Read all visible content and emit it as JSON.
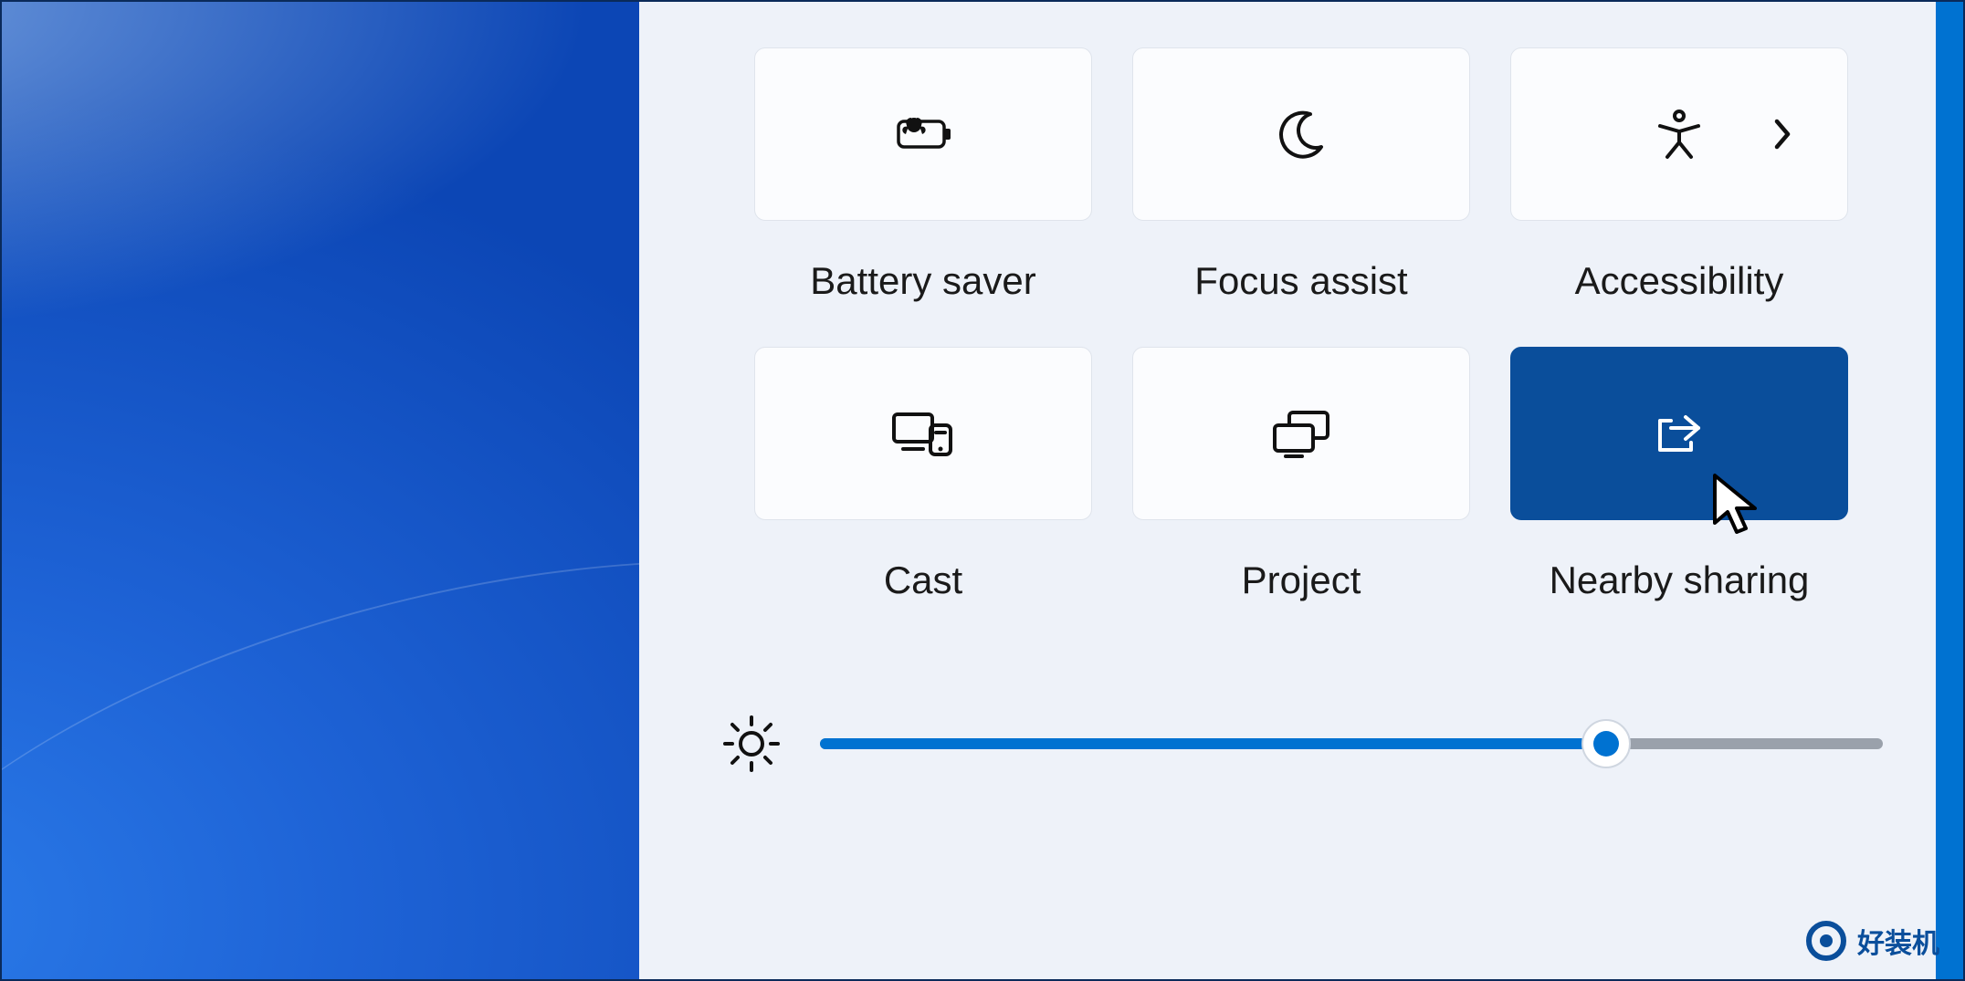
{
  "quick_settings": {
    "tiles": [
      {
        "id": "battery-saver",
        "label": "Battery saver",
        "icon": "battery-saver-icon",
        "active": false,
        "has_submenu": false
      },
      {
        "id": "focus-assist",
        "label": "Focus assist",
        "icon": "moon-icon",
        "active": false,
        "has_submenu": false
      },
      {
        "id": "accessibility",
        "label": "Accessibility",
        "icon": "accessibility-icon",
        "active": false,
        "has_submenu": true
      },
      {
        "id": "cast",
        "label": "Cast",
        "icon": "cast-icon",
        "active": false,
        "has_submenu": false
      },
      {
        "id": "project",
        "label": "Project",
        "icon": "project-icon",
        "active": false,
        "has_submenu": false
      },
      {
        "id": "nearby-sharing",
        "label": "Nearby sharing",
        "icon": "share-icon",
        "active": true,
        "has_submenu": false
      }
    ],
    "brightness": {
      "value": 74,
      "min": 0,
      "max": 100
    }
  },
  "colors": {
    "accent": "#0072d1",
    "tile_active": "#0a4e9b",
    "panel_bg": "#eef2f9"
  },
  "watermark": {
    "text": "好装机"
  }
}
